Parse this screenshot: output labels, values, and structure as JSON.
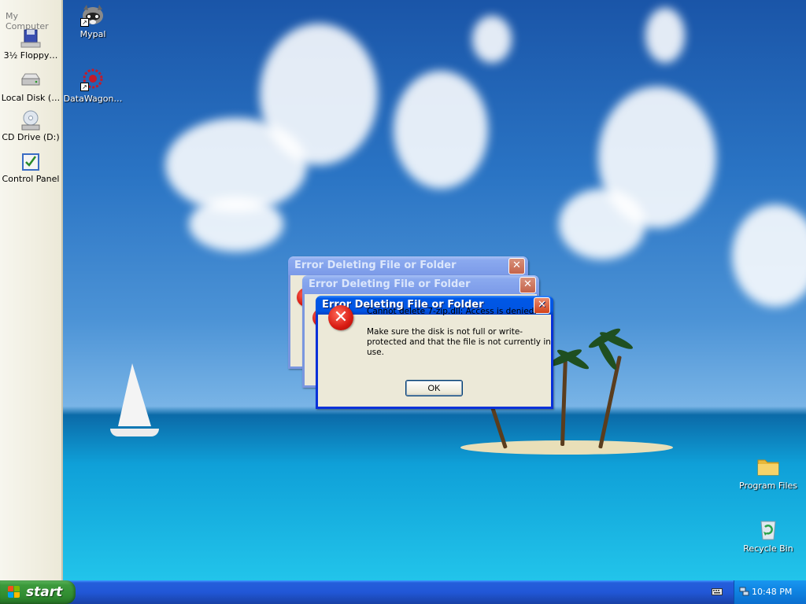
{
  "left_panel": {
    "header": "My Computer",
    "items": [
      {
        "label": "3½ Floppy…",
        "icon": "floppy-drive-icon"
      },
      {
        "label": "Local Disk (…",
        "icon": "hard-disk-icon"
      },
      {
        "label": "CD Drive (D:)",
        "icon": "cd-drive-icon"
      },
      {
        "label": "Control Panel",
        "icon": "control-panel-icon"
      }
    ]
  },
  "desktop_icons": {
    "mypal": {
      "label": "Mypal",
      "icon": "mypal-raccoon-icon"
    },
    "datawagon": {
      "label": "DataWagon…",
      "icon": "datawagon-icon"
    },
    "program_files": {
      "label": "Program Files",
      "icon": "folder-icon"
    },
    "recycle_bin": {
      "label": "Recycle Bin",
      "icon": "recycle-bin-icon"
    }
  },
  "dialogs": {
    "back1_title": "Error Deleting File or Folder",
    "back2_title": "Error Deleting File or Folder",
    "front": {
      "title": "Error Deleting File or Folder",
      "message_line1": "Cannot delete 7-zip.dll: Access is denied.",
      "message_line2": "Make sure the disk is not full or write-protected and that the file is not currently in use.",
      "ok_label": "OK",
      "close_glyph": "✕",
      "icon_glyph": "✕"
    }
  },
  "taskbar": {
    "start_label": "start",
    "clock": "10:48 PM"
  },
  "colors": {
    "title_active": "#0054e3",
    "title_inactive": "#7b9ae8",
    "start_green": "#3c9a3c",
    "dialog_bg": "#ece9d8",
    "error_red": "#d81b12"
  }
}
